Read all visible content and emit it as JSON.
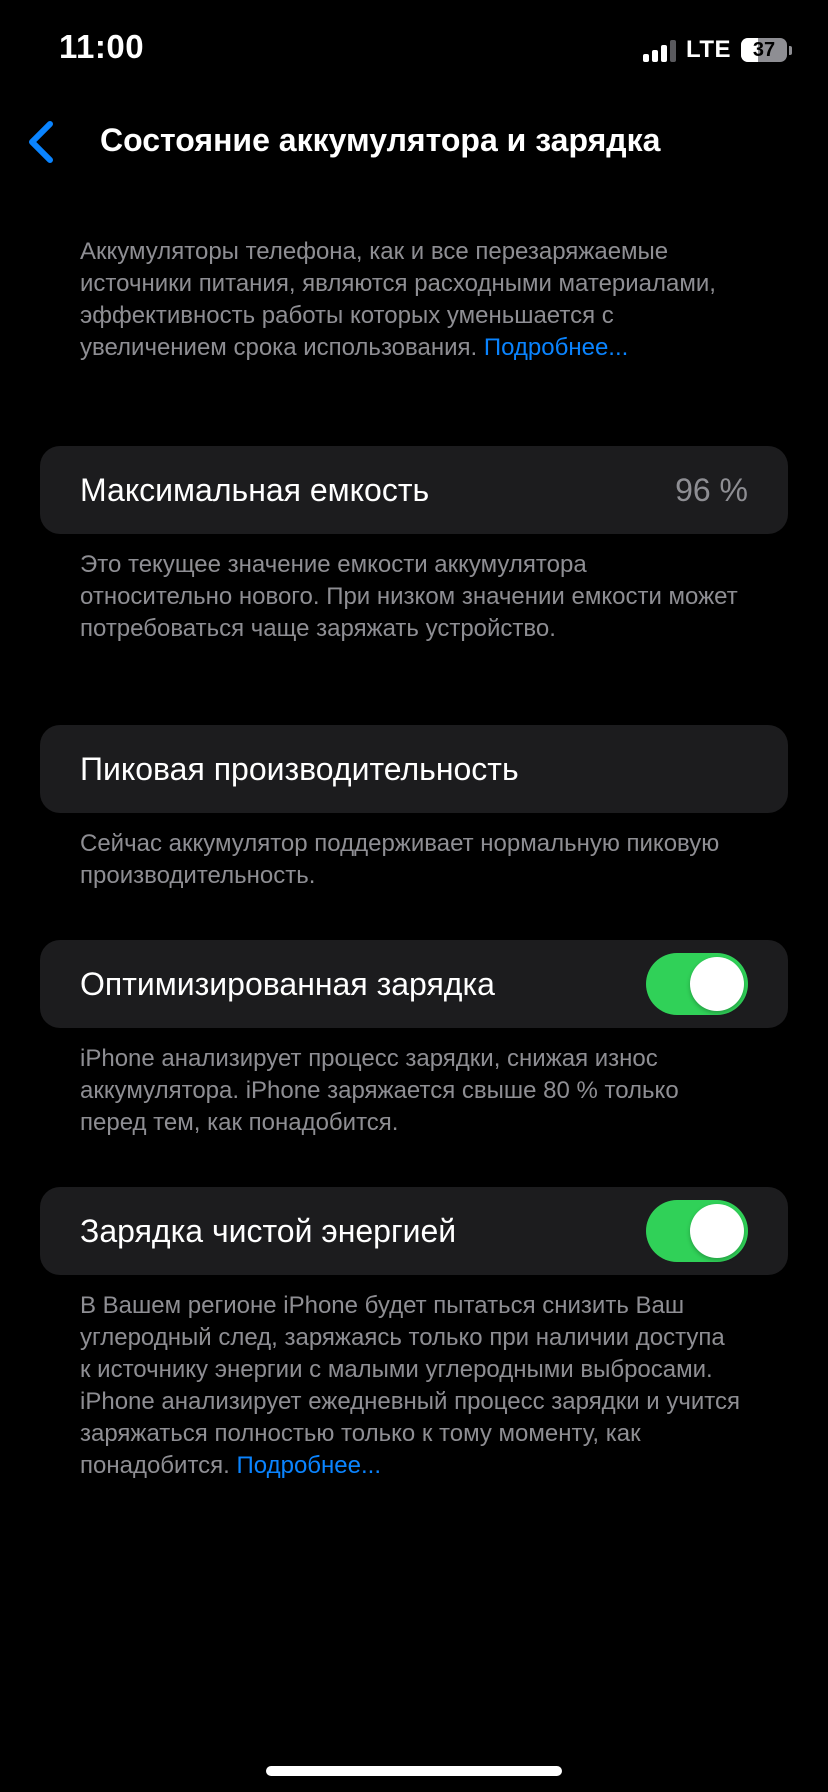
{
  "status_bar": {
    "time": "11:00",
    "network": "LTE",
    "battery_percent": "37",
    "battery_level": 0.37,
    "signal_bars": 3
  },
  "nav": {
    "back_icon": "chevron-left-icon",
    "title": "Состояние аккумулятора и зарядка"
  },
  "intro": {
    "text": "Аккумуляторы телефона, как и все перезаряжаемые источники питания, являются расходными материалами, эффективность работы которых уменьшается с увеличением срока использования. ",
    "link": "Подробнее..."
  },
  "max_capacity": {
    "label": "Максимальная емкость",
    "value": "96 %",
    "footnote": "Это текущее значение емкости аккумулятора относительно нового. При низком значении емкости может потребоваться чаще заряжать устройство."
  },
  "peak_performance": {
    "label": "Пиковая производительность",
    "footnote": "Сейчас аккумулятор поддерживает нормальную пиковую производительность."
  },
  "optimized_charging": {
    "label": "Оптимизированная зарядка",
    "enabled": true,
    "footnote": "iPhone анализирует процесс зарядки, снижая износ аккумулятора. iPhone заряжается свыше 80 % только перед тем, как понадобится."
  },
  "clean_energy_charging": {
    "label": "Зарядка чистой энергией",
    "enabled": true,
    "footnote": "В Вашем регионе iPhone будет пытаться снизить Ваш углеродный след, заряжаясь только при наличии доступа к источнику энергии с малыми углеродными выбросами. iPhone анализирует ежедневный процесс зарядки и учится заряжаться полностью только к тому моменту, как понадобится. ",
    "link": "Подробнее..."
  },
  "colors": {
    "background": "#000000",
    "cell": "#1c1c1e",
    "secondary_text": "#8e8e93",
    "link": "#0a84ff",
    "toggle_on": "#30d158"
  }
}
